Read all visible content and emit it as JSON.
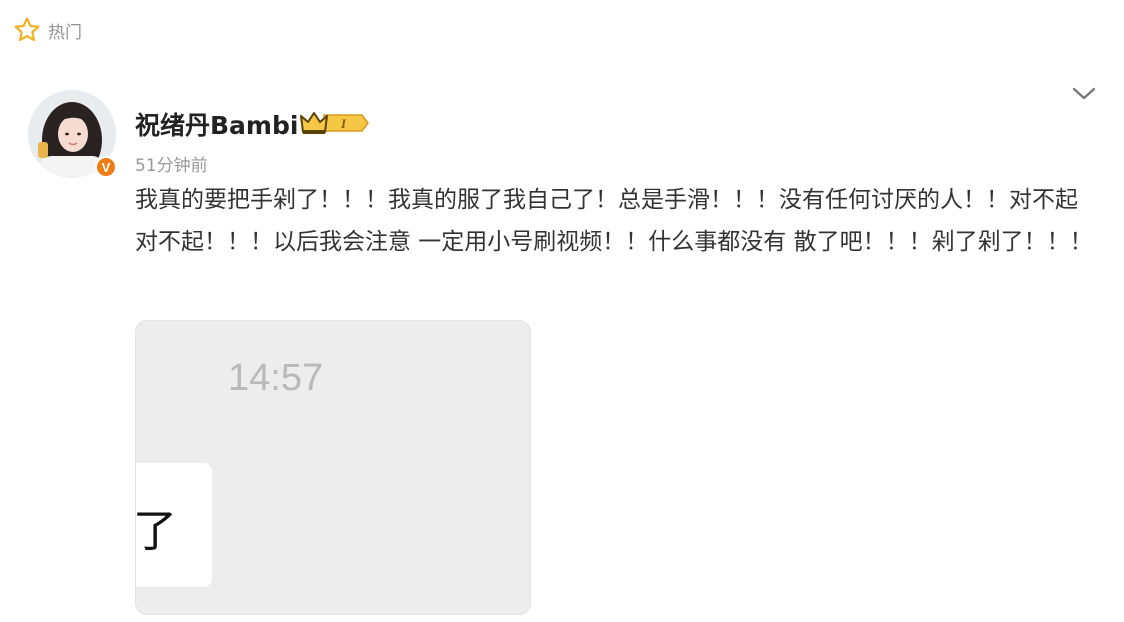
{
  "section": {
    "label": "热门",
    "icon": "star-outline-icon",
    "color": "#f0b429"
  },
  "post": {
    "author": {
      "name": "祝绪丹Bambi",
      "verified_badge_icon": "verified-v-icon",
      "vip_badge_icon": "crown-vip-level-icon",
      "vip_level": "I",
      "badge_color": "#f07c14"
    },
    "time": "51分钟前",
    "text": "我真的要把手剁了！！！我真的服了我自己了！总是手滑！！！没有任何讨厌的人！！对不起对不起！！！以后我会注意 一定用小号刷视频！！什么事都没有 散了吧！！！剁了剁了！！！",
    "menu_icon": "chevron-down-icon",
    "media": {
      "clock": "14:57",
      "bubble_char": "了"
    }
  }
}
